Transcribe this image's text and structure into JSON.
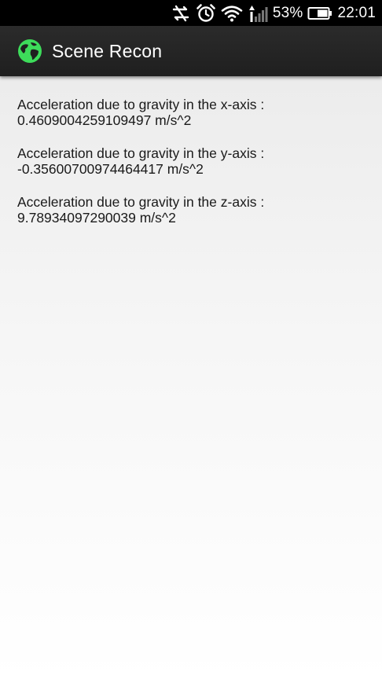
{
  "status_bar": {
    "icons": [
      "data-sync-off-icon",
      "alarm-clock-icon",
      "wifi-icon",
      "signal-strength-icon",
      "battery-icon"
    ],
    "battery_percent": "53%",
    "time": "22:01"
  },
  "action_bar": {
    "icon": "globe-icon",
    "title": "Scene Recon"
  },
  "readings": [
    {
      "label": "Acceleration due to gravity in the x-axis :",
      "value": "0.4609004259109497 m/s^2"
    },
    {
      "label": "Acceleration due to gravity in the y-axis :",
      "value": "-0.35600700974464417 m/s^2"
    },
    {
      "label": "Acceleration due to gravity in the z-axis :",
      "value": "9.78934097290039 m/s^2"
    }
  ],
  "colors": {
    "status_bar_bg": "#000000",
    "action_bar_bg": "#262626",
    "globe_accent": "#3ddc5a",
    "text": "#1a1a1a"
  }
}
